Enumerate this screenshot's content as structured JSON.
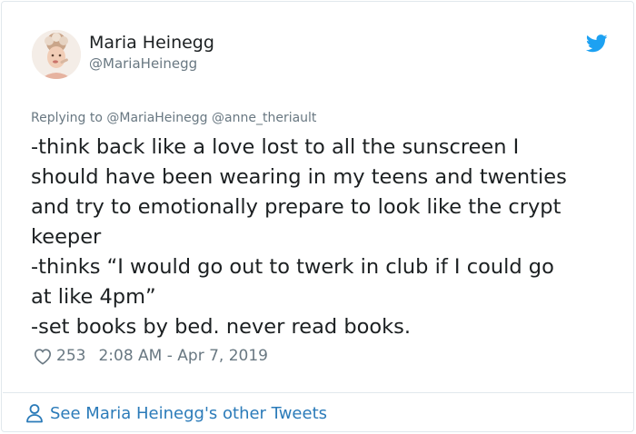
{
  "author": {
    "display_name": "Maria Heinegg",
    "handle": "@MariaHeinegg",
    "avatar_icon": "profile-photo"
  },
  "reply": {
    "prefix": "Replying to",
    "mentions": [
      "@MariaHeinegg",
      "@anne_theriault"
    ]
  },
  "tweet": {
    "lines": [
      "-think back like a love lost to all the sunscreen I",
      "should have been wearing in my teens and twenties",
      "and try to emotionally prepare to look like the crypt",
      "keeper",
      "-thinks “I would go out to twerk in club if I could go",
      "at like 4pm”",
      "-set books by bed. never read books."
    ]
  },
  "meta": {
    "likes": "253",
    "timestamp": "2:08 AM - Apr 7, 2019"
  },
  "footer": {
    "see_more_label": "See Maria Heinegg's other Tweets"
  },
  "colors": {
    "twitter_blue": "#1da1f2",
    "link_blue": "#2b7bb9",
    "muted_text": "#697882",
    "border": "#e1e8ed"
  },
  "icons": [
    "twitter-bird-icon",
    "heart-icon",
    "person-icon"
  ]
}
